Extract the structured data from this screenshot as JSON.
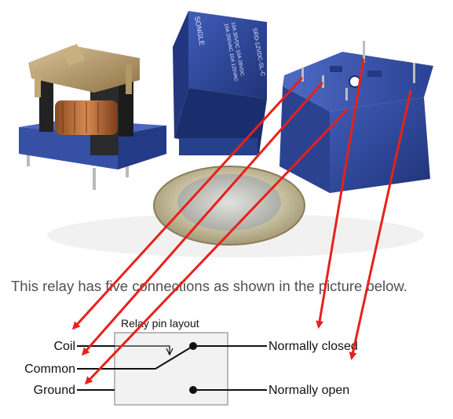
{
  "caption": "This relay has five connections as shown in the picture below.",
  "photo": {
    "relay_markings": {
      "brand": "SONGLE",
      "model": "SRD-12VDC-SL-C",
      "ratings": [
        "10A 250VAC 10A 125VAC",
        "10A 30VDC 10A 28VDC"
      ]
    }
  },
  "diagram": {
    "title": "Relay pin layout",
    "labels": {
      "coil": "Coil",
      "common": "Common",
      "ground": "Ground",
      "normally_closed": "Normally closed",
      "normally_open": "Normally open"
    }
  },
  "colors": {
    "arrow": "#e8201a",
    "relay_blue": "#2f4aa0",
    "box_fill": "#f2f2f2",
    "caption_text": "#505050"
  }
}
